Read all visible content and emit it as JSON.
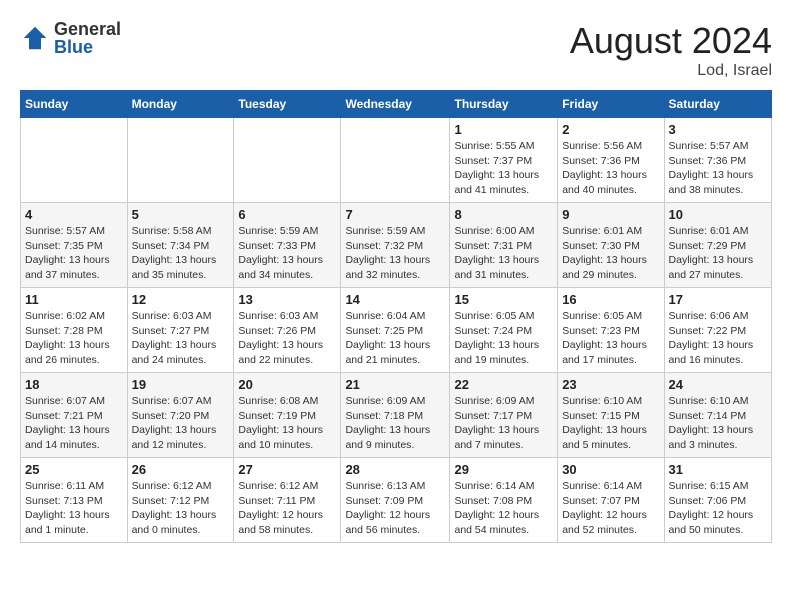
{
  "header": {
    "logo_general": "General",
    "logo_blue": "Blue",
    "main_title": "August 2024",
    "subtitle": "Lod, Israel"
  },
  "calendar": {
    "days_of_week": [
      "Sunday",
      "Monday",
      "Tuesday",
      "Wednesday",
      "Thursday",
      "Friday",
      "Saturday"
    ],
    "weeks": [
      [
        {
          "day": "",
          "info": ""
        },
        {
          "day": "",
          "info": ""
        },
        {
          "day": "",
          "info": ""
        },
        {
          "day": "",
          "info": ""
        },
        {
          "day": "1",
          "info": "Sunrise: 5:55 AM\nSunset: 7:37 PM\nDaylight: 13 hours\nand 41 minutes."
        },
        {
          "day": "2",
          "info": "Sunrise: 5:56 AM\nSunset: 7:36 PM\nDaylight: 13 hours\nand 40 minutes."
        },
        {
          "day": "3",
          "info": "Sunrise: 5:57 AM\nSunset: 7:36 PM\nDaylight: 13 hours\nand 38 minutes."
        }
      ],
      [
        {
          "day": "4",
          "info": "Sunrise: 5:57 AM\nSunset: 7:35 PM\nDaylight: 13 hours\nand 37 minutes."
        },
        {
          "day": "5",
          "info": "Sunrise: 5:58 AM\nSunset: 7:34 PM\nDaylight: 13 hours\nand 35 minutes."
        },
        {
          "day": "6",
          "info": "Sunrise: 5:59 AM\nSunset: 7:33 PM\nDaylight: 13 hours\nand 34 minutes."
        },
        {
          "day": "7",
          "info": "Sunrise: 5:59 AM\nSunset: 7:32 PM\nDaylight: 13 hours\nand 32 minutes."
        },
        {
          "day": "8",
          "info": "Sunrise: 6:00 AM\nSunset: 7:31 PM\nDaylight: 13 hours\nand 31 minutes."
        },
        {
          "day": "9",
          "info": "Sunrise: 6:01 AM\nSunset: 7:30 PM\nDaylight: 13 hours\nand 29 minutes."
        },
        {
          "day": "10",
          "info": "Sunrise: 6:01 AM\nSunset: 7:29 PM\nDaylight: 13 hours\nand 27 minutes."
        }
      ],
      [
        {
          "day": "11",
          "info": "Sunrise: 6:02 AM\nSunset: 7:28 PM\nDaylight: 13 hours\nand 26 minutes."
        },
        {
          "day": "12",
          "info": "Sunrise: 6:03 AM\nSunset: 7:27 PM\nDaylight: 13 hours\nand 24 minutes."
        },
        {
          "day": "13",
          "info": "Sunrise: 6:03 AM\nSunset: 7:26 PM\nDaylight: 13 hours\nand 22 minutes."
        },
        {
          "day": "14",
          "info": "Sunrise: 6:04 AM\nSunset: 7:25 PM\nDaylight: 13 hours\nand 21 minutes."
        },
        {
          "day": "15",
          "info": "Sunrise: 6:05 AM\nSunset: 7:24 PM\nDaylight: 13 hours\nand 19 minutes."
        },
        {
          "day": "16",
          "info": "Sunrise: 6:05 AM\nSunset: 7:23 PM\nDaylight: 13 hours\nand 17 minutes."
        },
        {
          "day": "17",
          "info": "Sunrise: 6:06 AM\nSunset: 7:22 PM\nDaylight: 13 hours\nand 16 minutes."
        }
      ],
      [
        {
          "day": "18",
          "info": "Sunrise: 6:07 AM\nSunset: 7:21 PM\nDaylight: 13 hours\nand 14 minutes."
        },
        {
          "day": "19",
          "info": "Sunrise: 6:07 AM\nSunset: 7:20 PM\nDaylight: 13 hours\nand 12 minutes."
        },
        {
          "day": "20",
          "info": "Sunrise: 6:08 AM\nSunset: 7:19 PM\nDaylight: 13 hours\nand 10 minutes."
        },
        {
          "day": "21",
          "info": "Sunrise: 6:09 AM\nSunset: 7:18 PM\nDaylight: 13 hours\nand 9 minutes."
        },
        {
          "day": "22",
          "info": "Sunrise: 6:09 AM\nSunset: 7:17 PM\nDaylight: 13 hours\nand 7 minutes."
        },
        {
          "day": "23",
          "info": "Sunrise: 6:10 AM\nSunset: 7:15 PM\nDaylight: 13 hours\nand 5 minutes."
        },
        {
          "day": "24",
          "info": "Sunrise: 6:10 AM\nSunset: 7:14 PM\nDaylight: 13 hours\nand 3 minutes."
        }
      ],
      [
        {
          "day": "25",
          "info": "Sunrise: 6:11 AM\nSunset: 7:13 PM\nDaylight: 13 hours\nand 1 minute."
        },
        {
          "day": "26",
          "info": "Sunrise: 6:12 AM\nSunset: 7:12 PM\nDaylight: 13 hours\nand 0 minutes."
        },
        {
          "day": "27",
          "info": "Sunrise: 6:12 AM\nSunset: 7:11 PM\nDaylight: 12 hours\nand 58 minutes."
        },
        {
          "day": "28",
          "info": "Sunrise: 6:13 AM\nSunset: 7:09 PM\nDaylight: 12 hours\nand 56 minutes."
        },
        {
          "day": "29",
          "info": "Sunrise: 6:14 AM\nSunset: 7:08 PM\nDaylight: 12 hours\nand 54 minutes."
        },
        {
          "day": "30",
          "info": "Sunrise: 6:14 AM\nSunset: 7:07 PM\nDaylight: 12 hours\nand 52 minutes."
        },
        {
          "day": "31",
          "info": "Sunrise: 6:15 AM\nSunset: 7:06 PM\nDaylight: 12 hours\nand 50 minutes."
        }
      ]
    ]
  }
}
